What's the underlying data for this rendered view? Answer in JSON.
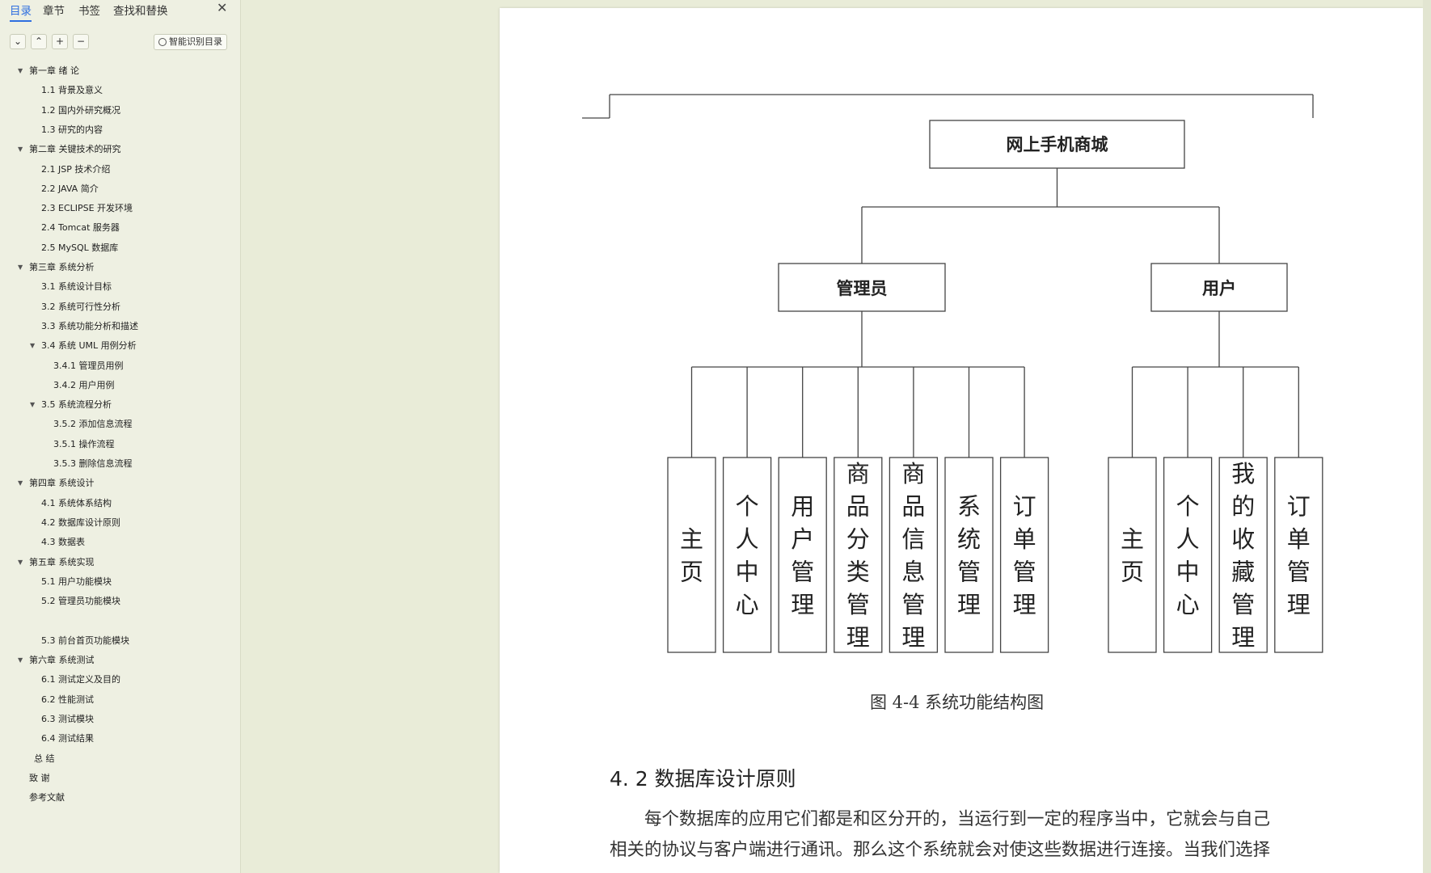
{
  "sidebar": {
    "tabs": [
      "目录",
      "章节",
      "书签",
      "查找和替换"
    ],
    "active_tab": "目录",
    "close_label": "✕",
    "toolbar": {
      "collapse_all": "⌄",
      "expand_all": "⌃",
      "add": "+",
      "remove": "−",
      "smart_label": "智能识别目录"
    },
    "toc": [
      {
        "label": "第一章  绪  论",
        "level": 0,
        "expandable": true
      },
      {
        "label": "1.1 背景及意义",
        "level": 1
      },
      {
        "label": "1.2 国内外研究概况",
        "level": 1
      },
      {
        "label": "1.3  研究的内容",
        "level": 1
      },
      {
        "label": "第二章  关键技术的研究",
        "level": 0,
        "expandable": true
      },
      {
        "label": "2.1 JSP 技术介绍",
        "level": 1
      },
      {
        "label": "2.2 JAVA 简介",
        "level": 1
      },
      {
        "label": "2.3 ECLIPSE  开发环境",
        "level": 1
      },
      {
        "label": "2.4 Tomcat 服务器",
        "level": 1
      },
      {
        "label": "2.5 MySQL 数据库",
        "level": 1
      },
      {
        "label": "第三章  系统分析",
        "level": 0,
        "expandable": true
      },
      {
        "label": "3.1  系统设计目标",
        "level": 1
      },
      {
        "label": "3.2  系统可行性分析",
        "level": 1
      },
      {
        "label": "3.3  系统功能分析和描述",
        "level": 1
      },
      {
        "label": "3.4 系统 UML 用例分析",
        "level": 1,
        "expandable": true
      },
      {
        "label": "3.4.1 管理员用例",
        "level": 2
      },
      {
        "label": "3.4.2 用户用例",
        "level": 2
      },
      {
        "label": "3.5 系统流程分析",
        "level": 1,
        "expandable": true
      },
      {
        "label": "3.5.2 添加信息流程",
        "level": 2
      },
      {
        "label": "3.5.1 操作流程",
        "level": 2
      },
      {
        "label": "3.5.3 删除信息流程",
        "level": 2
      },
      {
        "label": "第四章  系统设计",
        "level": 0,
        "expandable": true
      },
      {
        "label": "4.1  系统体系结构",
        "level": 1
      },
      {
        "label": "4.2  数据库设计原则",
        "level": 1
      },
      {
        "label": "4.3  数据表",
        "level": 1
      },
      {
        "label": "第五章  系统实现",
        "level": 0,
        "expandable": true
      },
      {
        "label": "5.1 用户功能模块",
        "level": 1
      },
      {
        "label": "5.2 管理员功能模块",
        "level": 1
      },
      {
        "label": "",
        "level": 1
      },
      {
        "label": "5.3 前台首页功能模块",
        "level": 1
      },
      {
        "label": "第六章    系统测试",
        "level": 0,
        "expandable": true
      },
      {
        "label": "6.1 测试定义及目的",
        "level": 1
      },
      {
        "label": "6.2 性能测试",
        "level": 1
      },
      {
        "label": "6.3 测试模块",
        "level": 1
      },
      {
        "label": "6.4 测试结果",
        "level": 1
      },
      {
        "label": "总  结",
        "level": 0.5
      },
      {
        "label": "致  谢",
        "level": 0
      },
      {
        "label": "参考文献",
        "level": 0
      }
    ]
  },
  "document": {
    "diagram": {
      "root": "网上手机商城",
      "admin": {
        "label": "管理员",
        "children": [
          "主页",
          "个人中心",
          "用户管理",
          "商品分类管理",
          "商品信息管理",
          "系统管理",
          "订单管理"
        ]
      },
      "user": {
        "label": "用户",
        "children": [
          "主页",
          "个人中心",
          "我的收藏管理",
          "订单管理"
        ]
      }
    },
    "caption": "图 4-4 系统功能结构图",
    "section_heading": "4. 2  数据库设计原则",
    "paragraph_lines": [
      "每个数据库的应用它们都是和区分开的，当运行到一定的程序当中，它就会与自己",
      "相关的协议与客户端进行通讯。那么这个系统就会对使这些数据进行连接。当我们选择"
    ]
  }
}
